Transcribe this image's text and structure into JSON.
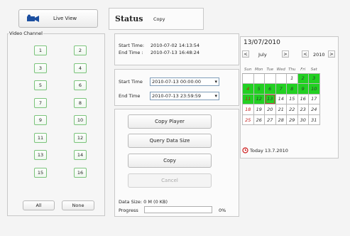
{
  "toolbar": {
    "live_view_label": "Live View",
    "status_label": "Status",
    "mode_label": "Copy"
  },
  "video_channel": {
    "legend": "Video Channel",
    "channels": [
      "1",
      "2",
      "3",
      "4",
      "5",
      "6",
      "7",
      "8",
      "9",
      "10",
      "11",
      "12",
      "13",
      "14",
      "15",
      "16"
    ],
    "all_label": "All",
    "none_label": "None"
  },
  "info": {
    "start_label": "Start Time:",
    "start_value": "2010-07-02 14:13:54",
    "end_label": "End Time :",
    "end_value": "2010-07-13 16:48:24"
  },
  "range": {
    "start_label": "Start Time",
    "start_value": "2010-07-13 00:00:00",
    "end_label": "End Time",
    "end_value": "2010-07-13 23:59:59"
  },
  "actions": {
    "copy_player": "Copy Player",
    "query_data_size": "Query Data Size",
    "copy": "Copy",
    "cancel": "Cancel"
  },
  "progress": {
    "data_size_label": "Data Size: 0 M (0 KB)",
    "progress_label": "Progress",
    "percent_text": "0%",
    "value": 0
  },
  "calendar": {
    "date_header": "13/07/2010",
    "month_prev": "<",
    "month": "July",
    "month_next": ">",
    "year_prev": "<",
    "year": "2010",
    "year_next": ">",
    "weekdays": [
      "Sun",
      "Mon",
      "Tue",
      "Wed",
      "Thu",
      "Fri",
      "Sat"
    ],
    "weeks": [
      [
        "",
        "",
        "",
        "",
        "1",
        "2",
        "3"
      ],
      [
        "4",
        "5",
        "6",
        "7",
        "8",
        "9",
        "10"
      ],
      [
        "11",
        "12",
        "13",
        "14",
        "15",
        "16",
        "17"
      ],
      [
        "18",
        "19",
        "20",
        "21",
        "22",
        "23",
        "24"
      ],
      [
        "25",
        "26",
        "27",
        "28",
        "29",
        "30",
        "31"
      ]
    ],
    "recorded_days": [
      "2",
      "3",
      "4",
      "5",
      "6",
      "7",
      "8",
      "9",
      "10",
      "11",
      "12",
      "13"
    ],
    "today_label": "Today 13.7.2010",
    "colors": {
      "recorded": "#22d022",
      "sunday": "#c01818"
    }
  }
}
